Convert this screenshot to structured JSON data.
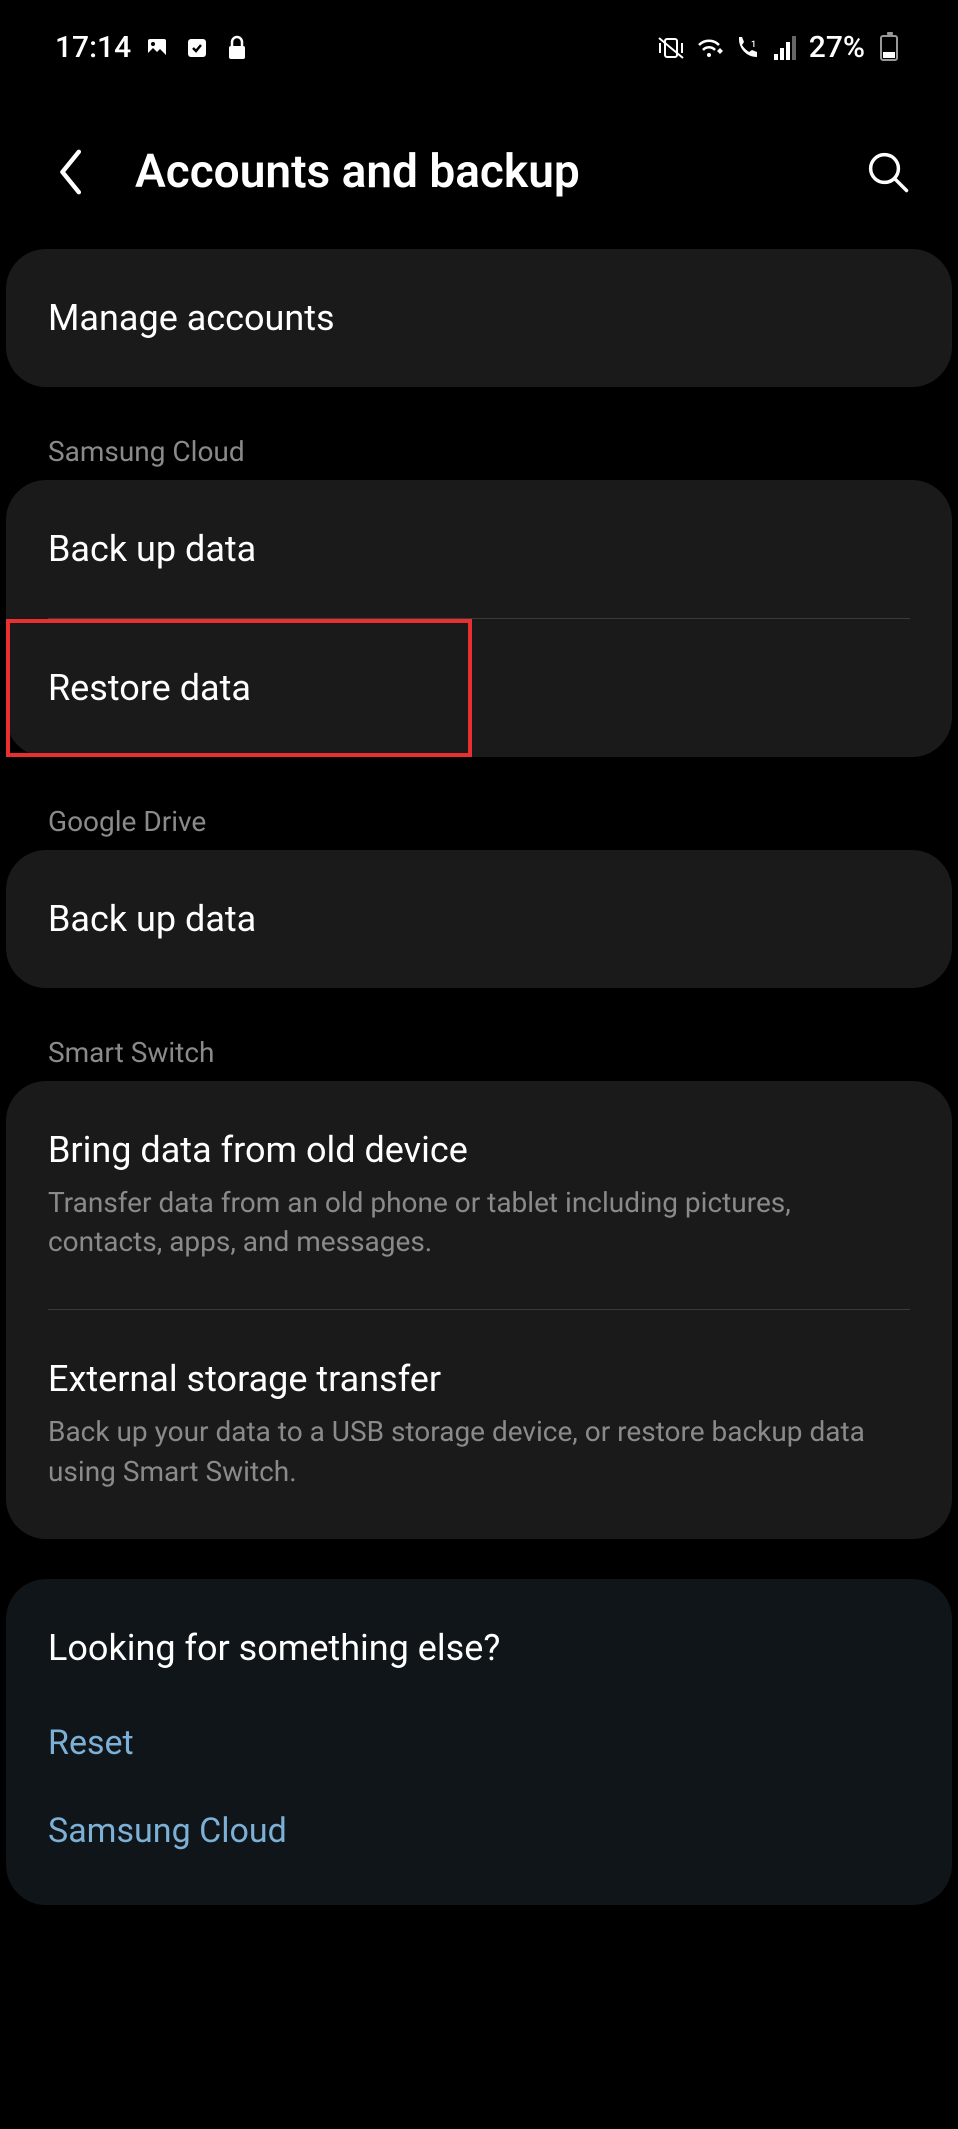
{
  "status": {
    "time": "17:14",
    "battery": "27%"
  },
  "header": {
    "title": "Accounts and backup"
  },
  "sections": {
    "manage_accounts": "Manage accounts",
    "samsung_cloud": {
      "header": "Samsung Cloud",
      "backup": "Back up data",
      "restore": "Restore data"
    },
    "google_drive": {
      "header": "Google Drive",
      "backup": "Back up data"
    },
    "smart_switch": {
      "header": "Smart Switch",
      "bring": {
        "title": "Bring data from old device",
        "desc": "Transfer data from an old phone or tablet including pictures, contacts, apps, and messages."
      },
      "external": {
        "title": "External storage transfer",
        "desc": "Back up your data to a USB storage device, or restore backup data using Smart Switch."
      }
    }
  },
  "footer": {
    "title": "Looking for something else?",
    "links": {
      "reset": "Reset",
      "samsung_cloud": "Samsung Cloud"
    }
  }
}
